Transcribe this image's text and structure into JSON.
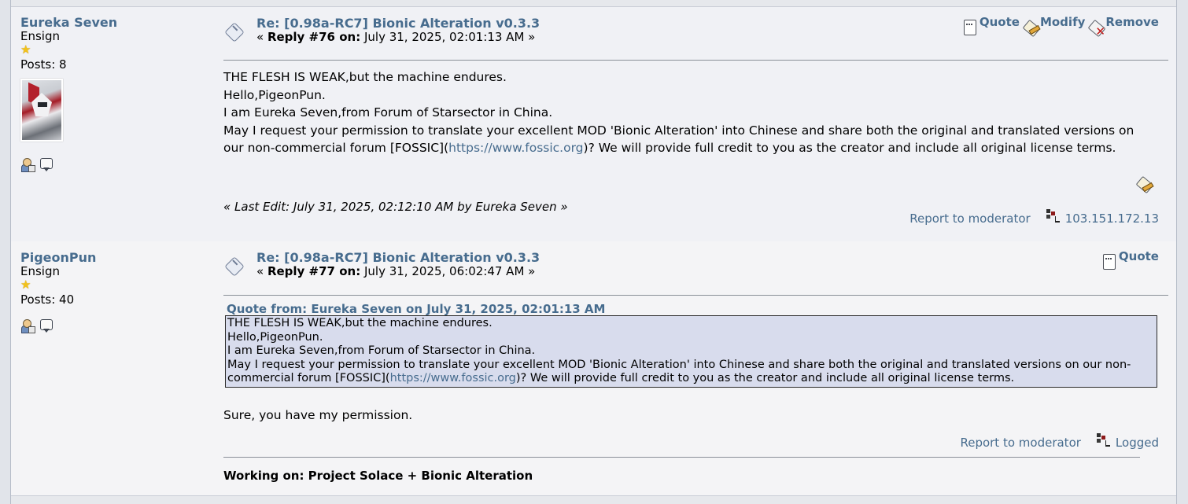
{
  "posts": [
    {
      "poster": {
        "name": "Eureka Seven",
        "rank": "Ensign",
        "stars": "★",
        "posts": "Posts: 8"
      },
      "subject": "Re: [0.98a-RC7] Bionic Alteration v0.3.3",
      "reply_prefix": "« ",
      "reply_label": "Reply #76 on:",
      "reply_date": " July 31, 2025, 02:01:13 AM »",
      "actions": {
        "quote": "Quote",
        "modify": "Modify",
        "remove": "Remove"
      },
      "lines": [
        "THE FLESH IS WEAK,but the machine endures.",
        "Hello,PigeonPun.",
        "I am Eureka Seven,from Forum of Starsector in China."
      ],
      "para_pre": "May I request your permission to translate your excellent MOD 'Bionic Alteration' into Chinese and share both the original and translated versions on our non-commercial forum [FOSSIC](",
      "link": "https://www.fossic.org",
      "para_post": ")? We will provide full credit to you as the creator and include all original license terms.",
      "last_edit_pre": "« ",
      "last_edit": "Last Edit: July 31, 2025, 02:12:10 AM by Eureka Seven",
      "last_edit_post": " »",
      "report": "Report to moderator",
      "ip": "103.151.172.13"
    },
    {
      "poster": {
        "name": "PigeonPun",
        "rank": "Ensign",
        "stars": "★",
        "posts": "Posts: 40"
      },
      "subject": "Re: [0.98a-RC7] Bionic Alteration v0.3.3",
      "reply_prefix": "« ",
      "reply_label": "Reply #77 on:",
      "reply_date": " July 31, 2025, 06:02:47 AM »",
      "actions": {
        "quote": "Quote"
      },
      "quote_header": "Quote from: Eureka Seven on July 31, 2025, 02:01:13 AM",
      "quote_lines": [
        "THE FLESH IS WEAK,but the machine endures.",
        "Hello,PigeonPun.",
        "I am Eureka Seven,from Forum of Starsector in China."
      ],
      "quote_para_pre": "May I request your permission to translate your excellent MOD 'Bionic Alteration' into Chinese and share both the original and translated versions on our non-commercial forum [FOSSIC](",
      "quote_link": "https://www.fossic.org",
      "quote_para_post": ")? We will provide full credit to you as the creator and include all original license terms.",
      "reply_text": "Sure, you have my permission.",
      "report": "Report to moderator",
      "logged": "Logged",
      "signature": "Working on: Project Solace + Bionic Alteration"
    }
  ]
}
